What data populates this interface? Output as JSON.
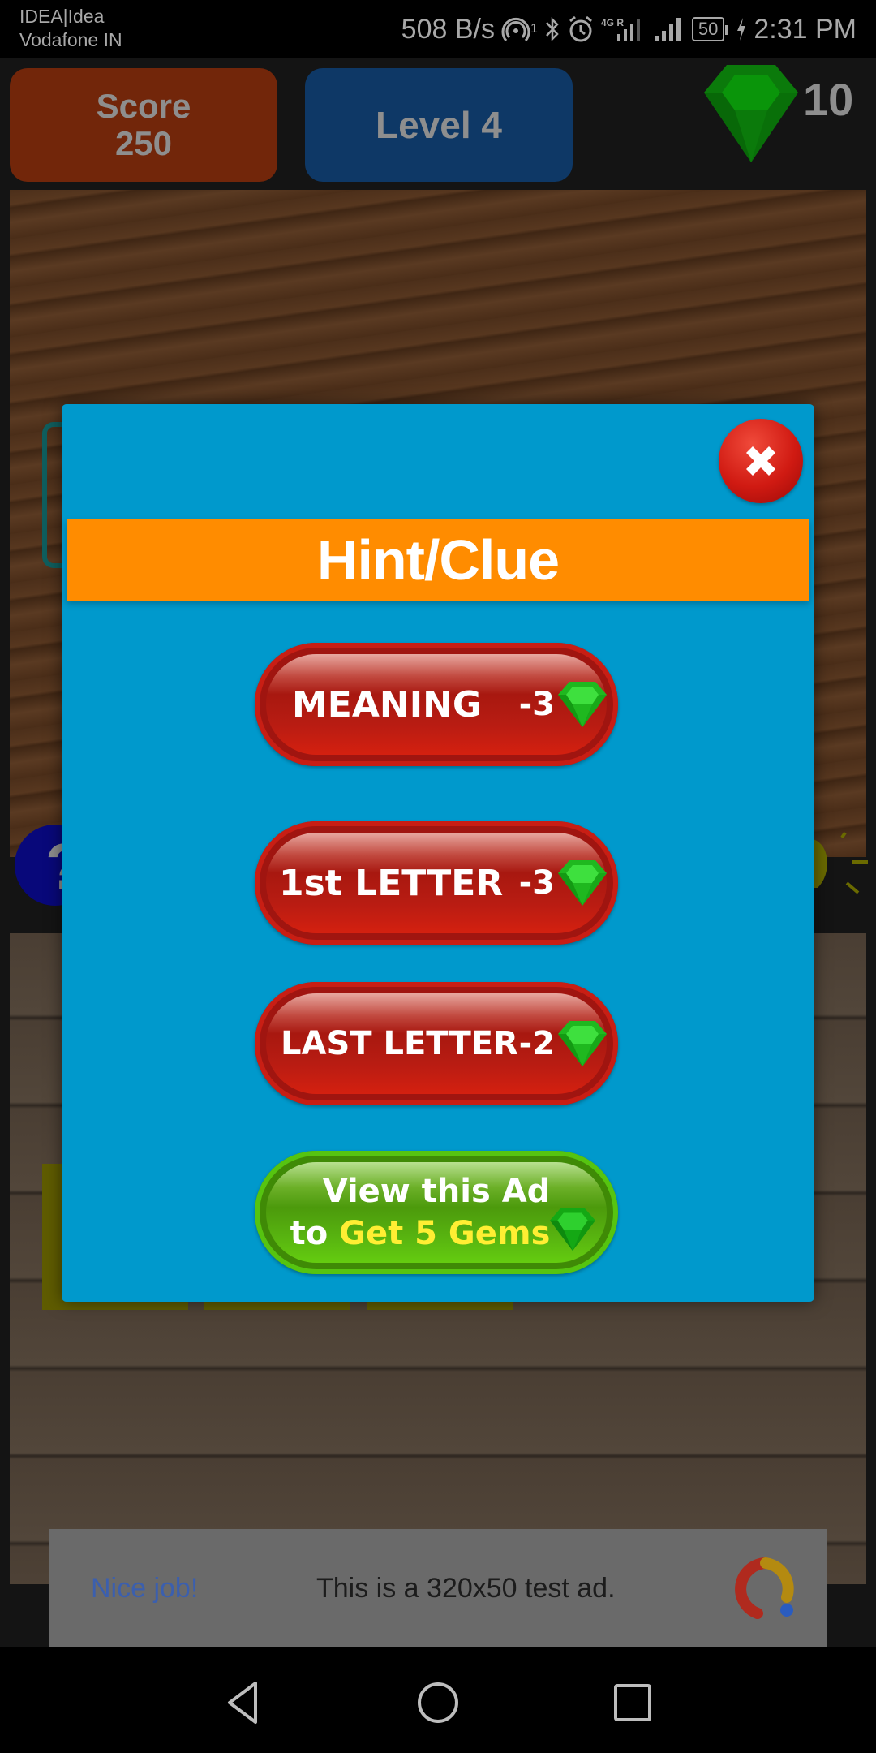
{
  "status_bar": {
    "carrier_line1": "IDEA|Idea",
    "carrier_line2": "Vodafone IN",
    "net_speed": "508 B/s",
    "hotspot_count": "1",
    "network_type": "4G R",
    "battery_level": "50",
    "time": "2:31 PM",
    "icons": [
      "hotspot-icon",
      "bluetooth-icon",
      "alarm-icon",
      "signal-4g-icon",
      "signal-icon",
      "battery-icon",
      "charging-icon"
    ]
  },
  "hud": {
    "score_label": "Score",
    "score_value": "250",
    "level_label": "Level 4",
    "gems_count": "10",
    "colors": {
      "score_bg": "#72260a",
      "level_bg": "#0e3866",
      "gem": "#0c8a0c"
    }
  },
  "dialog": {
    "title": "Hint/Clue",
    "title_bg": "#ff8c00",
    "body_bg": "#0099cc",
    "close_icon": "close-icon",
    "options": [
      {
        "label": "MEANING",
        "cost": "-3",
        "icon": "gem-icon",
        "style": "red"
      },
      {
        "label": "1st LETTER",
        "cost": "-3",
        "icon": "gem-icon",
        "style": "red"
      },
      {
        "label": "LAST LETTER",
        "cost": "-2",
        "icon": "gem-icon",
        "style": "red"
      }
    ],
    "ad_button": {
      "line1": "View this Ad",
      "line2_prefix": "to ",
      "line2_highlight": "Get 5 Gems",
      "icon": "gem-icon"
    }
  },
  "ad_banner": {
    "headline": "Nice job!",
    "text": "This is a 320x50 test ad.",
    "logo": "ad-logo-icon"
  },
  "nav_bar": {
    "buttons": [
      "back-icon",
      "home-icon",
      "recents-icon"
    ]
  }
}
